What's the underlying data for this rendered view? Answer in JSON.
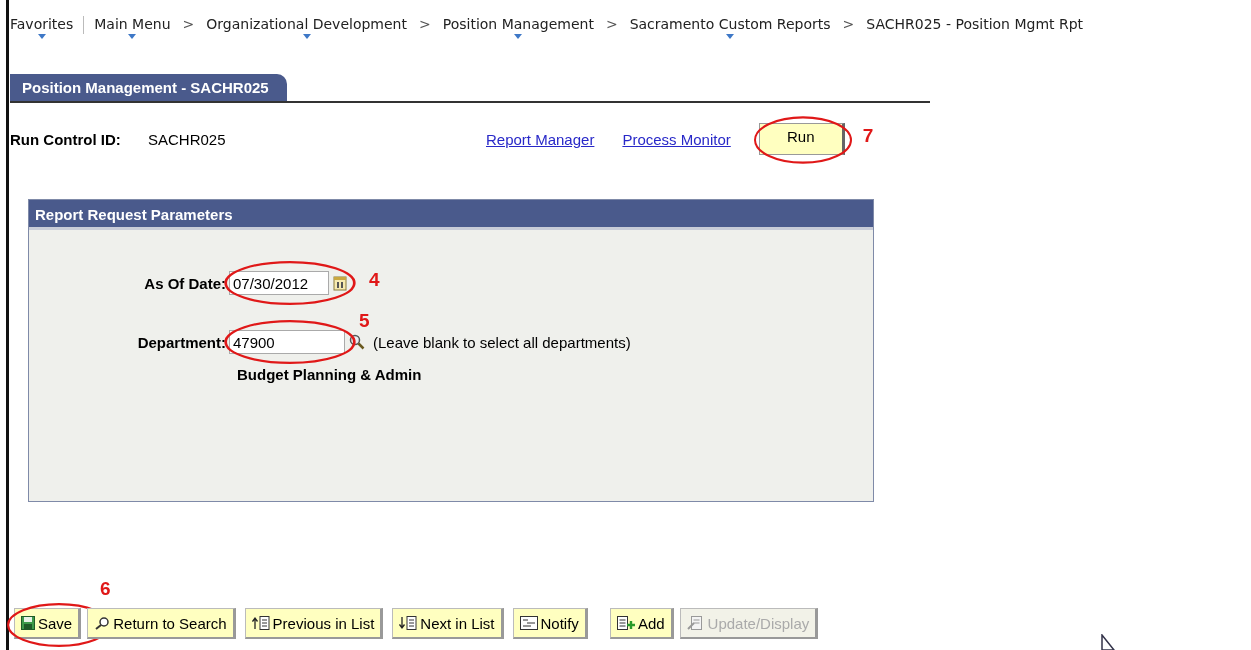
{
  "breadcrumb": [
    {
      "label": "Favorites",
      "menu": true
    },
    {
      "label": "Main Menu",
      "menu": true
    },
    {
      "label": "Organizational Development",
      "separator": ">",
      "menu": true
    },
    {
      "label": "Position Management",
      "separator": ">",
      "menu": true
    },
    {
      "label": "Sacramento Custom Reports",
      "separator": ">",
      "menu": true
    },
    {
      "label": "SACHR025 - Position Mgmt Rpt",
      "separator": ">",
      "menu": false
    }
  ],
  "tab": {
    "label": "Position Management - SACHR025",
    "selected": true
  },
  "run_control": {
    "label": "Run Control ID:",
    "value": "SACHR025"
  },
  "links": [
    "Report Manager",
    "Process Monitor"
  ],
  "run_button": {
    "label": "Run",
    "callout": "7"
  },
  "group": {
    "title": "Report Request Parameters",
    "fields": [
      {
        "kind": "date",
        "label": "As Of Date:",
        "value": "07/30/2012",
        "callout": "4"
      },
      {
        "kind": "lookup",
        "label": "Department:",
        "value": "47900",
        "callout": "5",
        "hint": "(Leave blank to select all departments)",
        "description": "Budget Planning & Admin"
      }
    ]
  },
  "toolbar": [
    {
      "kind": "save",
      "label": "Save",
      "disabled": false,
      "callout": "6"
    },
    {
      "kind": "search",
      "label": "Return to Search",
      "disabled": false
    },
    {
      "kind": "previous",
      "label": "Previous in List",
      "disabled": false
    },
    {
      "kind": "next",
      "label": "Next in List",
      "disabled": false
    },
    {
      "kind": "notify",
      "label": "Notify",
      "disabled": false
    },
    {
      "kind": "add",
      "label": "Add",
      "disabled": false
    },
    {
      "kind": "update",
      "label": "Update/Display",
      "disabled": true
    }
  ]
}
